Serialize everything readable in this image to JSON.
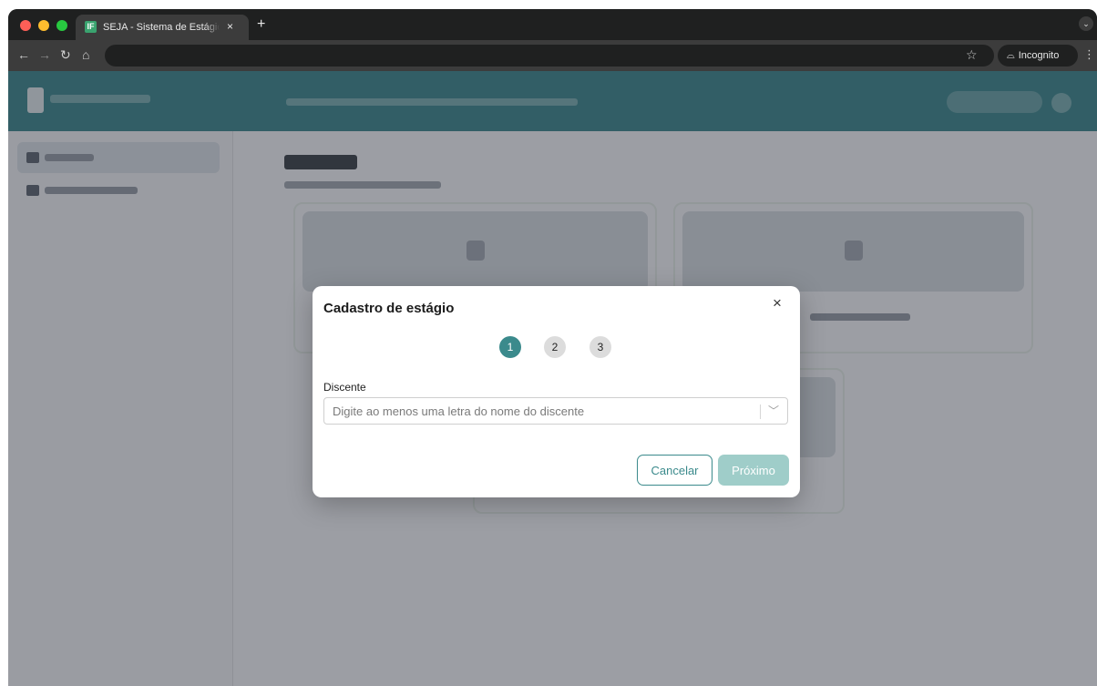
{
  "browser": {
    "tab_title": "SEJA - Sistema de Estágios e",
    "tab_favicon_letter": "IF",
    "tab_close": "×",
    "new_tab": "+",
    "incognito_label": "Incognito"
  },
  "modal": {
    "title": "Cadastro de estágio",
    "close_symbol": "×",
    "steps": [
      "1",
      "2",
      "3"
    ],
    "active_step": 1,
    "field_label": "Discente",
    "field_placeholder": "Digite ao menos uma letra do nome do discente",
    "cancel_label": "Cancelar",
    "next_label": "Próximo"
  },
  "colors": {
    "accent": "#3b8a8c",
    "next_disabled": "#9fcdc9"
  }
}
